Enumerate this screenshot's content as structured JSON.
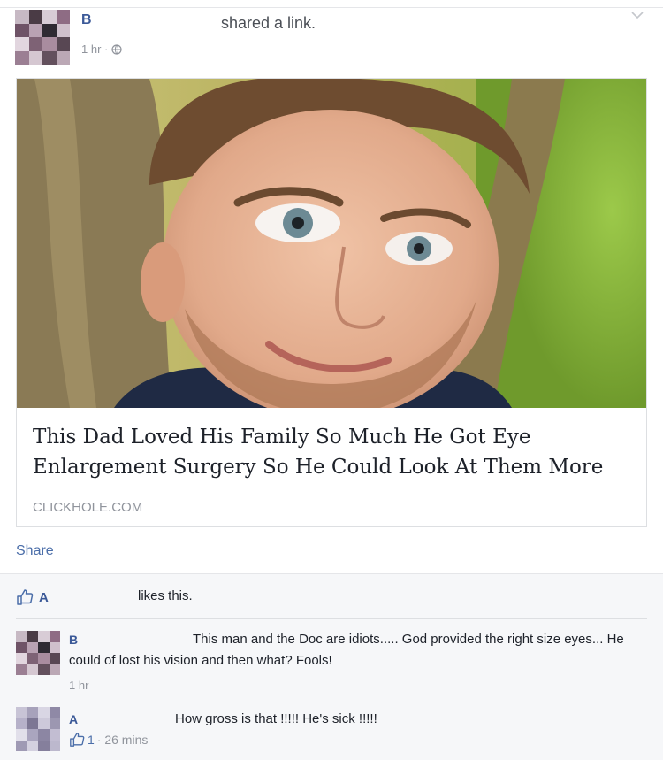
{
  "post": {
    "author": "B",
    "action": "shared a link.",
    "time": "1 hr ·",
    "link": {
      "title": "This Dad Loved His Family So Much He Got Eye Enlargement Surgery So He Could Look At Them More",
      "domain": "CLICKHOLE.COM"
    },
    "share_label": "Share"
  },
  "likes": {
    "name": "A",
    "text": "likes this."
  },
  "comments": [
    {
      "author": "B",
      "text": "This man and the Doc are idiots..... God provided the right size eyes... He could of lost his vision and then what? Fools!",
      "time": "1 hr"
    },
    {
      "author": "A",
      "text": "How gross is that !!!!! He's sick !!!!!",
      "likes": "1",
      "time": "· 26 mins"
    }
  ],
  "icons": {
    "globe": "globe-icon",
    "chevron": "chevron-down-icon",
    "like": "thumbs-up-icon"
  },
  "colors": {
    "link_blue": "#3b5998",
    "muted_gray": "#90949c",
    "feedback_bg": "#f6f7f9"
  }
}
